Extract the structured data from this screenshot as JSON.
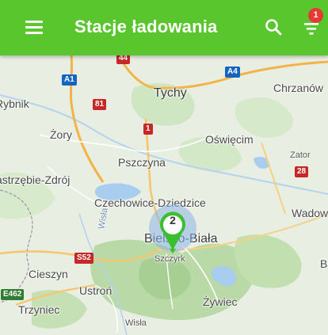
{
  "app": {
    "title": "Stacje ładowania"
  },
  "toolbar": {
    "filter_badge": "1"
  },
  "map": {
    "cluster_count": "2",
    "places": {
      "rybnik": "Rybnik",
      "tychy": "Tychy",
      "chrzanow": "Chrzanów",
      "zory": "Żory",
      "oswiecim": "Oświęcim",
      "pszczyna": "Pszczyna",
      "zator": "Zator",
      "jastrzebie": "Jastrzębie-Zdrój",
      "czechowice": "Czechowice-Dziedzice",
      "wadowice": "Wadow",
      "bielsko": "Bielsko-Biała",
      "cieszyn": "Cieszyn",
      "ustron": "Ustroń",
      "szczyrk": "Szczyrk",
      "zywiec": "Żywiec",
      "trzyniec": "Trzyniec",
      "wisla_town": "Wisła",
      "wisla_river": "Wisła",
      "b_edge": "B"
    },
    "roads": {
      "a1": "A1",
      "a4": "A4",
      "r44": "44",
      "r81": "81",
      "r1": "1",
      "r28": "28",
      "s52": "S52",
      "e462": "E462"
    }
  }
}
